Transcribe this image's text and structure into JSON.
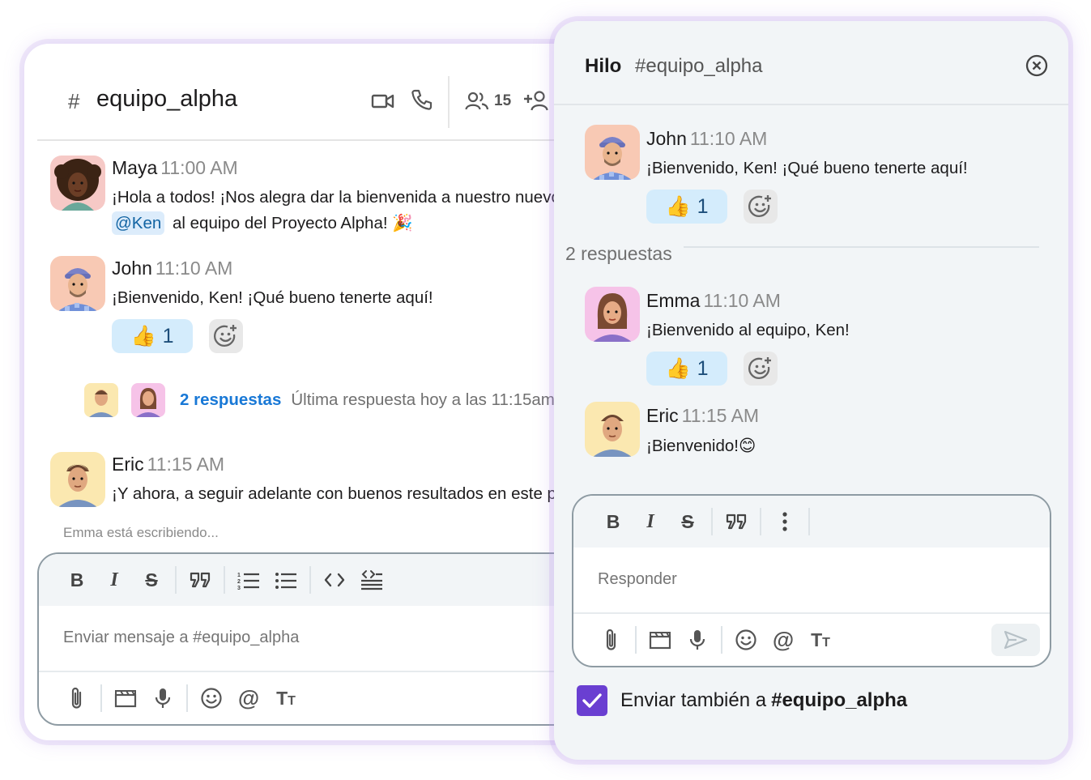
{
  "channel": {
    "hash": "#",
    "name": "equipo_alpha",
    "member_count": "15",
    "messages": [
      {
        "author": "Maya",
        "time": "11:00 AM",
        "line1": "¡Hola a todos! ¡Nos alegra dar la bienvenida a nuestro nuevo miembro",
        "mention": "@Ken",
        "line2": "al equipo del Proyecto Alpha! 🎉"
      },
      {
        "author": "John",
        "time": "11:10 AM",
        "text": "¡Bienvenido, Ken! ¡Qué bueno tenerte aquí!",
        "reaction_emoji": "👍",
        "reaction_count": "1"
      },
      {
        "author": "Eric",
        "time": "11:15 AM",
        "text": "¡Y ahora, a seguir adelante con buenos resultados en este proyecto!"
      }
    ],
    "thread_summary": {
      "link": "2 respuestas",
      "last": "Última respuesta hoy a las 11:15am"
    },
    "typing": "Emma está escribiendo...",
    "composer_placeholder": "Enviar mensaje a #equipo_alpha"
  },
  "thread": {
    "title": "Hilo",
    "channel": "#equipo_alpha",
    "parent": {
      "author": "John",
      "time": "11:10 AM",
      "text": "¡Bienvenido, Ken! ¡Qué bueno tenerte aquí!",
      "reaction_emoji": "👍",
      "reaction_count": "1"
    },
    "replies_label": "2 respuestas",
    "replies": [
      {
        "author": "Emma",
        "time": "11:10 AM",
        "text": "¡Bienvenido al equipo, Ken!",
        "reaction_emoji": "👍",
        "reaction_count": "1"
      },
      {
        "author": "Eric",
        "time": "11:15 AM",
        "text": "¡Bienvenido!😊"
      }
    ],
    "composer_placeholder": "Responder",
    "also_send_label": "Enviar también a",
    "also_send_channel": "#equipo_alpha"
  },
  "icons": {
    "video": "video-camera-icon",
    "call": "phone-icon",
    "members": "users-icon",
    "add_member": "add-user-icon",
    "close": "close-circle-icon",
    "send": "send-icon"
  },
  "colors": {
    "accent": "#6a3fd1",
    "link": "#1878d6",
    "reaction_bg": "#d4ecfc",
    "panel_bg": "#f2f5f7"
  }
}
